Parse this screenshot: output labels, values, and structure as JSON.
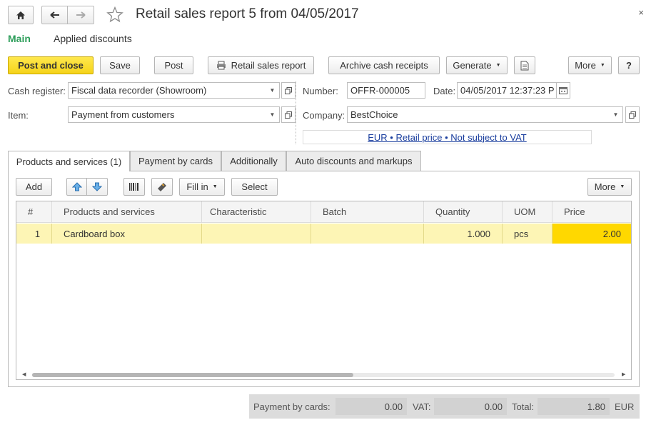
{
  "window": {
    "title": "Retail sales report 5 from 04/05/2017"
  },
  "sections": {
    "main": "Main",
    "applied_discounts": "Applied discounts"
  },
  "toolbar": {
    "post_and_close": "Post and close",
    "save": "Save",
    "post": "Post",
    "retail_sales_report": "Retail sales report",
    "archive_cash_receipts": "Archive cash receipts",
    "generate": "Generate",
    "more": "More",
    "help": "?"
  },
  "form": {
    "cash_register_label": "Cash register:",
    "cash_register_value": "Fiscal data recorder (Showroom)",
    "item_label": "Item:",
    "item_value": "Payment from customers",
    "number_label": "Number:",
    "number_value": "OFFR-000005",
    "date_label": "Date:",
    "date_value": "04/05/2017 12:37:23 P",
    "company_label": "Company:",
    "company_value": "BestChoice",
    "price_settings_link": "EUR • Retail price • Not subject to VAT"
  },
  "tabs": [
    {
      "label": "Products and services (1)",
      "active": true
    },
    {
      "label": "Payment by cards",
      "active": false
    },
    {
      "label": "Additionally",
      "active": false
    },
    {
      "label": "Auto discounts and markups",
      "active": false
    }
  ],
  "table_toolbar": {
    "add": "Add",
    "fill_in": "Fill in",
    "select": "Select",
    "more": "More"
  },
  "table": {
    "columns": [
      "#",
      "Products and services",
      "Characteristic",
      "Batch",
      "Quantity",
      "UOM",
      "Price"
    ],
    "rows": [
      {
        "num": "1",
        "product": "Cardboard box",
        "characteristic": "",
        "batch": "",
        "quantity": "1.000",
        "uom": "pcs",
        "price": "2.00"
      }
    ]
  },
  "totals": {
    "payment_by_cards_label": "Payment by cards:",
    "payment_by_cards_value": "0.00",
    "vat_label": "VAT:",
    "vat_value": "0.00",
    "total_label": "Total:",
    "total_value": "1.80",
    "currency": "EUR"
  },
  "colors": {
    "accent_green": "#2e9e5b",
    "primary_button": "#f5d31a",
    "row_highlight": "#fdf5b5",
    "price_cell": "#ffd800",
    "link_blue": "#1a3e9e"
  }
}
